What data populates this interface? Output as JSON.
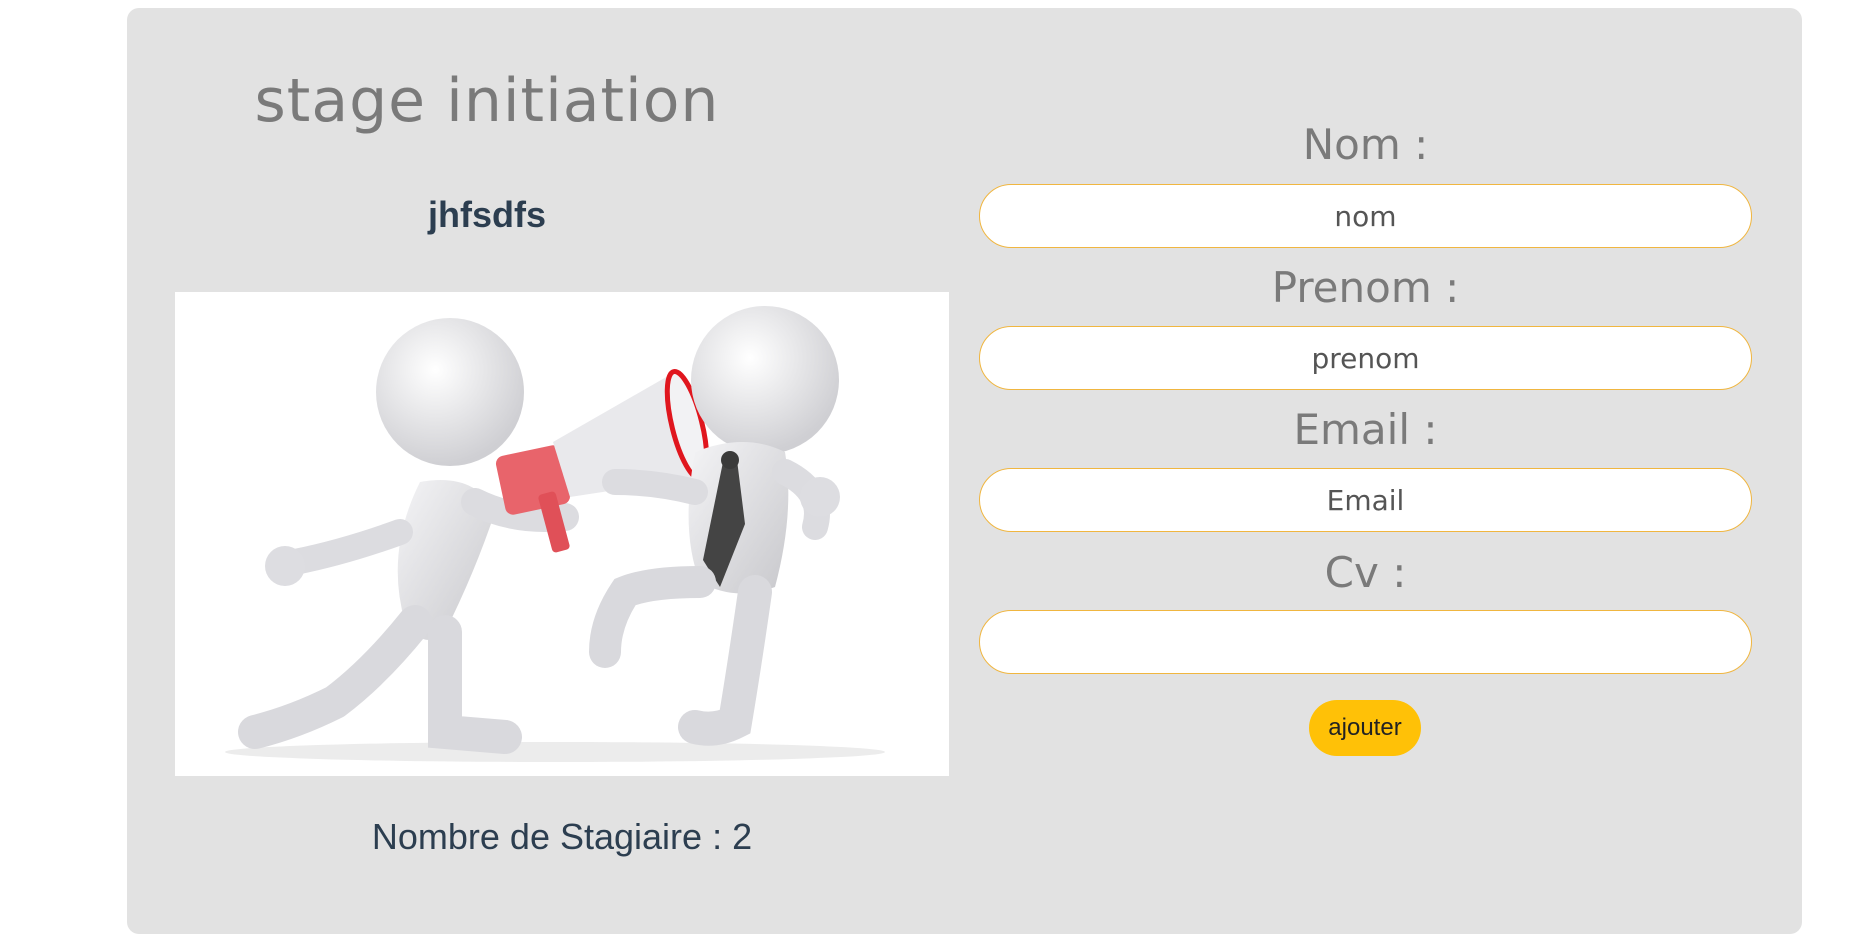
{
  "left": {
    "title": "stage initiation",
    "subtitle": "jhfsdfs",
    "count_text": "Nombre de Stagiaire : 2"
  },
  "form": {
    "fields": [
      {
        "label": "Nom :",
        "placeholder": "nom"
      },
      {
        "label": "Prenom :",
        "placeholder": "prenom"
      },
      {
        "label": "Email :",
        "placeholder": "Email"
      },
      {
        "label": "Cv :",
        "placeholder": ""
      }
    ],
    "submit_label": "ajouter"
  },
  "colors": {
    "card_background": "#e2e2e2",
    "input_border": "#f0b640",
    "button_background": "#ffc107",
    "megaphone": "#e85a62",
    "tie": "#444444"
  }
}
